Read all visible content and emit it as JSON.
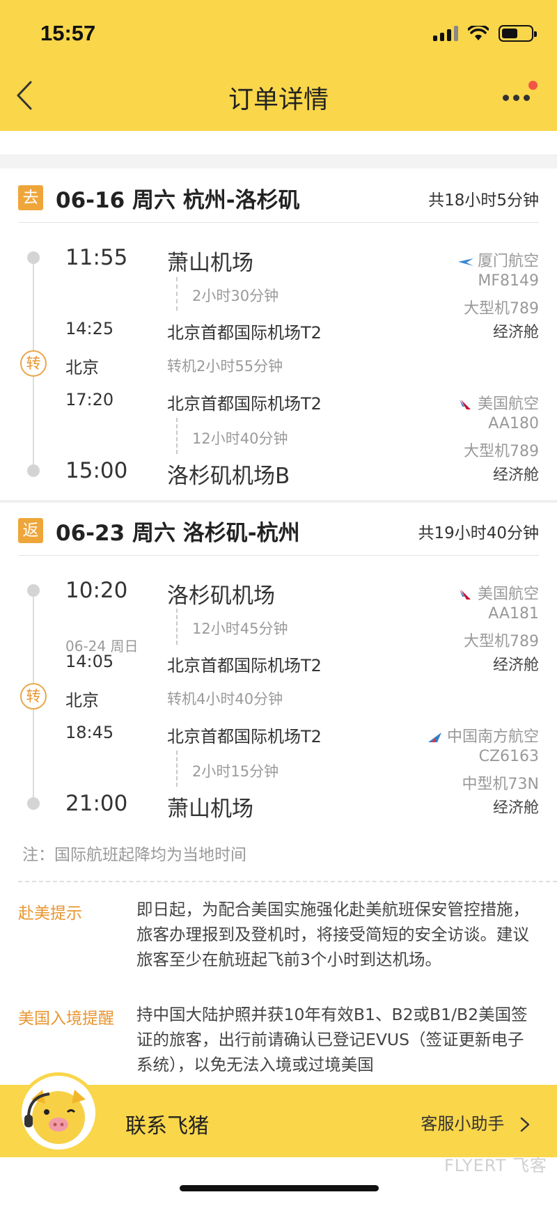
{
  "status_bar": {
    "time": "15:57"
  },
  "nav": {
    "title": "订单详情"
  },
  "outbound": {
    "badge": "去",
    "date_route": "06-16 周六 杭州-洛杉矶",
    "total": "共18小时5分钟",
    "dep1_time": "11:55",
    "dep1_airport": "萧山机场",
    "leg1_duration": "2小时30分钟",
    "arr1_time": "14:25",
    "arr1_airport": "北京首都国际机场T2",
    "transfer_badge": "转",
    "transfer_city": "北京",
    "transfer_info": "转机2小时55分钟",
    "dep2_time": "17:20",
    "dep2_airport": "北京首都国际机场T2",
    "leg2_duration": "12小时40分钟",
    "arr2_time": "15:00",
    "arr2_airport": "洛杉矶机场B",
    "leg1_airline": "厦门航空",
    "leg1_flight": "MF8149",
    "leg1_aircraft": "大型机789",
    "leg1_cabin": "经济舱",
    "leg2_airline": "美国航空",
    "leg2_flight": "AA180",
    "leg2_aircraft": "大型机789",
    "leg2_cabin": "经济舱"
  },
  "return": {
    "badge": "返",
    "date_route": "06-23 周六 洛杉矶-杭州",
    "total": "共19小时40分钟",
    "dep1_time": "10:20",
    "dep1_airport": "洛杉矶机场",
    "leg1_duration": "12小时45分钟",
    "arr1_date": "06-24 周日",
    "arr1_time": "14:05",
    "arr1_airport": "北京首都国际机场T2",
    "transfer_badge": "转",
    "transfer_city": "北京",
    "transfer_info": "转机4小时40分钟",
    "dep2_time": "18:45",
    "dep2_airport": "北京首都国际机场T2",
    "leg2_duration": "2小时15分钟",
    "arr2_time": "21:00",
    "arr2_airport": "萧山机场",
    "leg1_airline": "美国航空",
    "leg1_flight": "AA181",
    "leg1_aircraft": "大型机789",
    "leg1_cabin": "经济舱",
    "leg2_airline": "中国南方航空",
    "leg2_flight": "CZ6163",
    "leg2_aircraft": "中型机73N",
    "leg2_cabin": "经济舱"
  },
  "note": "注：国际航班起降均为当地时间",
  "tips": {
    "us_label": "赴美提示",
    "us_body": "即日起，为配合美国实施强化赴美航班保安管控措施，旅客办理报到及登机时，将接受简短的安全访谈。建议旅客至少在航班起飞前3个小时到达机场。",
    "entry_label": "美国入境提醒",
    "entry_body": "持中国大陆护照并获10年有效B1、B2或B1/B2美国签证的旅客，出行前请确认已登记EVUS（签证更新电子系统），以免无法入境或过境美国"
  },
  "bottom": {
    "contact": "联系飞猪",
    "assistant": "客服小助手"
  },
  "watermark": "FLYERT 飞客",
  "colors": {
    "header": "#f9d64a",
    "accent": "#eea63b",
    "tip": "#e9952f"
  }
}
